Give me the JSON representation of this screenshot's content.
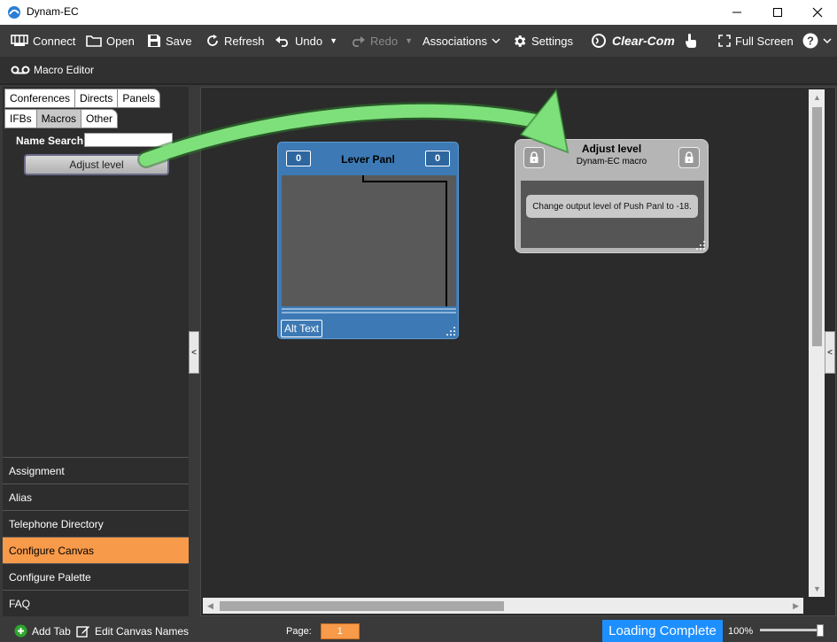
{
  "window": {
    "title": "Dynam-EC"
  },
  "toolbar": {
    "connect": "Connect",
    "open": "Open",
    "save": "Save",
    "refresh": "Refresh",
    "undo": "Undo",
    "redo": "Redo",
    "associations": "Associations",
    "settings": "Settings",
    "brand": "Clear-Com",
    "fullscreen": "Full Screen"
  },
  "editor": {
    "label": "Macro Editor"
  },
  "left_panel": {
    "tabs_row1": [
      "Conferences",
      "Directs",
      "Panels"
    ],
    "tabs_row2": [
      "IFBs",
      "Macros",
      "Other"
    ],
    "active_tab": "Macros",
    "name_search_label": "Name Search",
    "search_value": "",
    "macro_items": [
      "Adjust level"
    ],
    "nav": [
      "Assignment",
      "Alias",
      "Telephone Directory",
      "Configure Canvas",
      "Configure Palette",
      "FAQ"
    ],
    "active_nav": "Configure Canvas"
  },
  "canvas": {
    "lever_panel": {
      "title": "Lever Panl",
      "left_count": "0",
      "right_count": "0",
      "alt_text": "Alt Text"
    },
    "macro_widget": {
      "title": "Adjust level",
      "subtitle": "Dynam-EC macro",
      "description": "Change output level of Push Panl to -18."
    }
  },
  "statusbar": {
    "add_tab": "Add Tab",
    "edit_canvas_names": "Edit Canvas Names",
    "page_label": "Page:",
    "page_value": "1",
    "status": "Loading Complete",
    "zoom": "100%"
  },
  "colors": {
    "accent_orange": "#f79a4a",
    "status_blue": "#1e8fff",
    "lever_blue": "#3d7ab5",
    "arrow_green": "#7ee07a"
  }
}
